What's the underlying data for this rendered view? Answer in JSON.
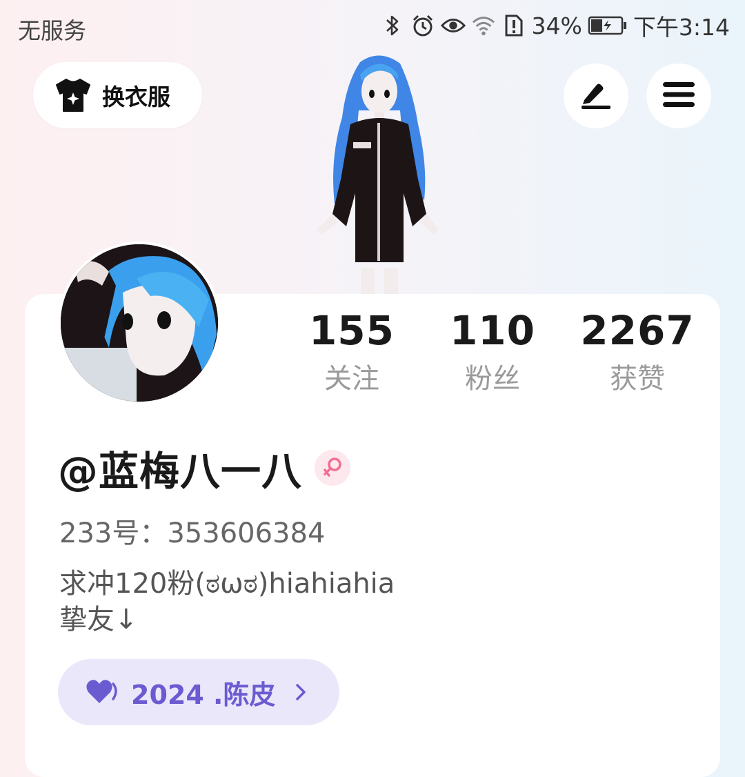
{
  "status_bar": {
    "carrier": "无服务",
    "icons": [
      "bluetooth-icon",
      "alarm-icon",
      "eye-icon",
      "wifi-icon",
      "sim-alert-icon",
      "battery-charging-icon"
    ],
    "battery": "34%",
    "time": "下午3:14"
  },
  "header": {
    "outfit_button": {
      "label": "换衣服",
      "icon": "tshirt-sparkle-icon"
    },
    "edit_button": {
      "icon": "pen-icon"
    },
    "menu_button": {
      "icon": "hamburger-menu-icon"
    }
  },
  "profile": {
    "stats": [
      {
        "value": "155",
        "label": "关注"
      },
      {
        "value": "110",
        "label": "粉丝"
      },
      {
        "value": "2267",
        "label": "获赞"
      }
    ],
    "username": "@蓝梅八一八",
    "gender_icon": "female-icon",
    "uid": "233号：353606384",
    "bio_lines": [
      "求冲120粉(ಠωಠ)hiahiahia",
      "挚友↓"
    ],
    "fan_badge": {
      "icon": "heart-icon",
      "label": "2024 .陈皮"
    }
  },
  "colors": {
    "accent": "#6b5bd1",
    "chip_bg": "#ebe7fb",
    "gender": "#f06e92"
  }
}
